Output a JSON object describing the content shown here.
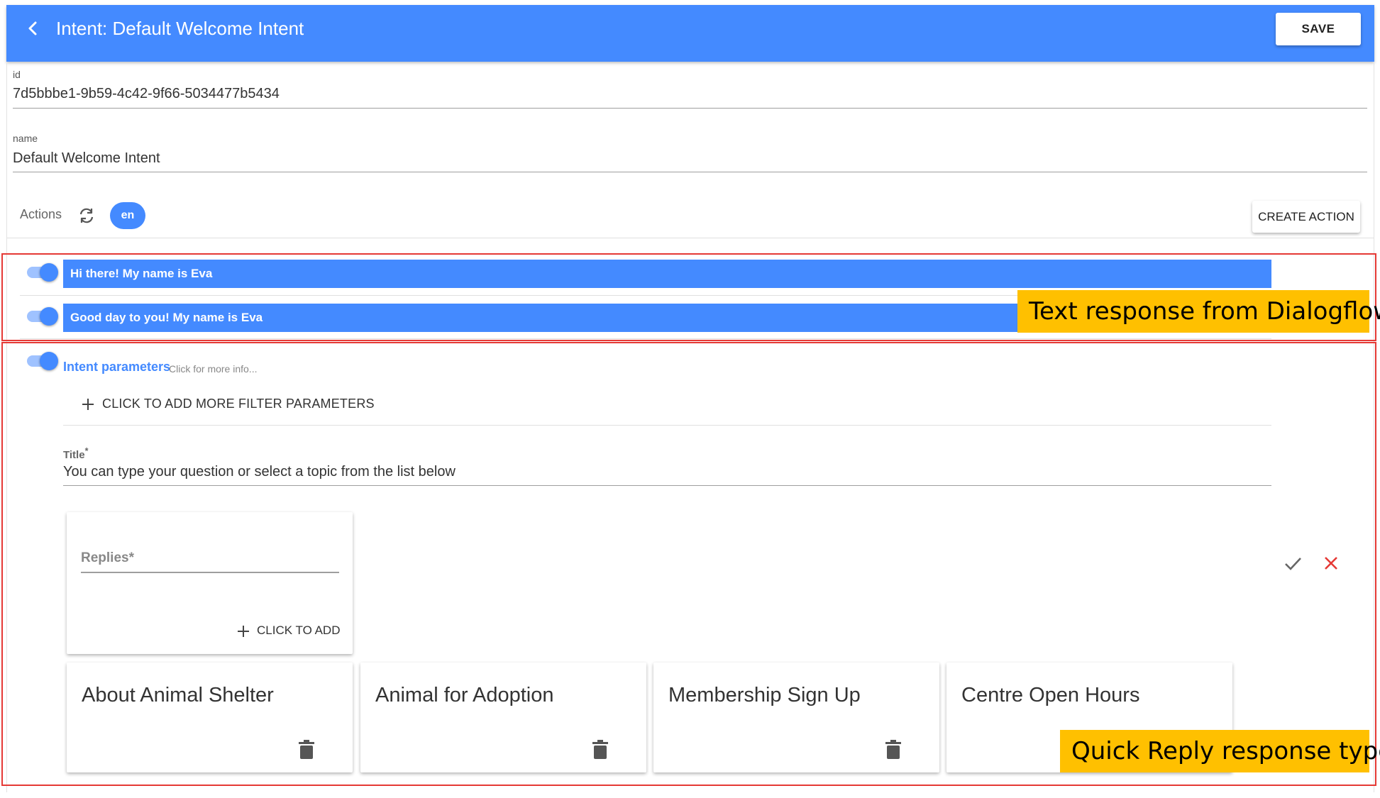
{
  "header": {
    "title": "Intent: Default Welcome Intent",
    "save_label": "SAVE",
    "color": "#448aff"
  },
  "fields": {
    "id": {
      "label": "id",
      "value": "7d5bbbe1-9b59-4c42-9f66-5034477b5434"
    },
    "name": {
      "label": "name",
      "value": "Default Welcome Intent"
    }
  },
  "actions": {
    "label": "Actions",
    "language": "en",
    "create_label": "CREATE ACTION"
  },
  "text_responses": [
    {
      "text": "Hi there! My name is Eva",
      "enabled": true
    },
    {
      "text": "Good day to you! My name is Eva",
      "enabled": true
    }
  ],
  "intent_parameters": {
    "link": "Intent parameters",
    "hint": "Click for more info...",
    "filter_label": "CLICK TO ADD MORE FILTER PARAMETERS",
    "enabled": true
  },
  "title_field": {
    "label": "Title",
    "required_mark": "*",
    "value": "You can type your question or select a topic from the list below"
  },
  "replies_card": {
    "label": "Replies",
    "required_mark": "*",
    "add_label": "CLICK TO ADD"
  },
  "quick_replies": [
    {
      "text": "About Animal Shelter"
    },
    {
      "text": "Animal for Adoption"
    },
    {
      "text": "Membership Sign Up"
    },
    {
      "text": "Centre Open Hours"
    }
  ],
  "callouts": {
    "text_response": "Text response from Dialogflow",
    "quick_reply": "Quick Reply response type"
  },
  "icons": {
    "back": "chevron-left-icon",
    "refresh": "sync-icon",
    "plus": "plus-icon",
    "check": "check-icon",
    "close": "close-icon",
    "delete": "trash-icon"
  },
  "colors": {
    "accent": "#448aff",
    "callout": "#ffc000",
    "frame": "#e53935"
  }
}
